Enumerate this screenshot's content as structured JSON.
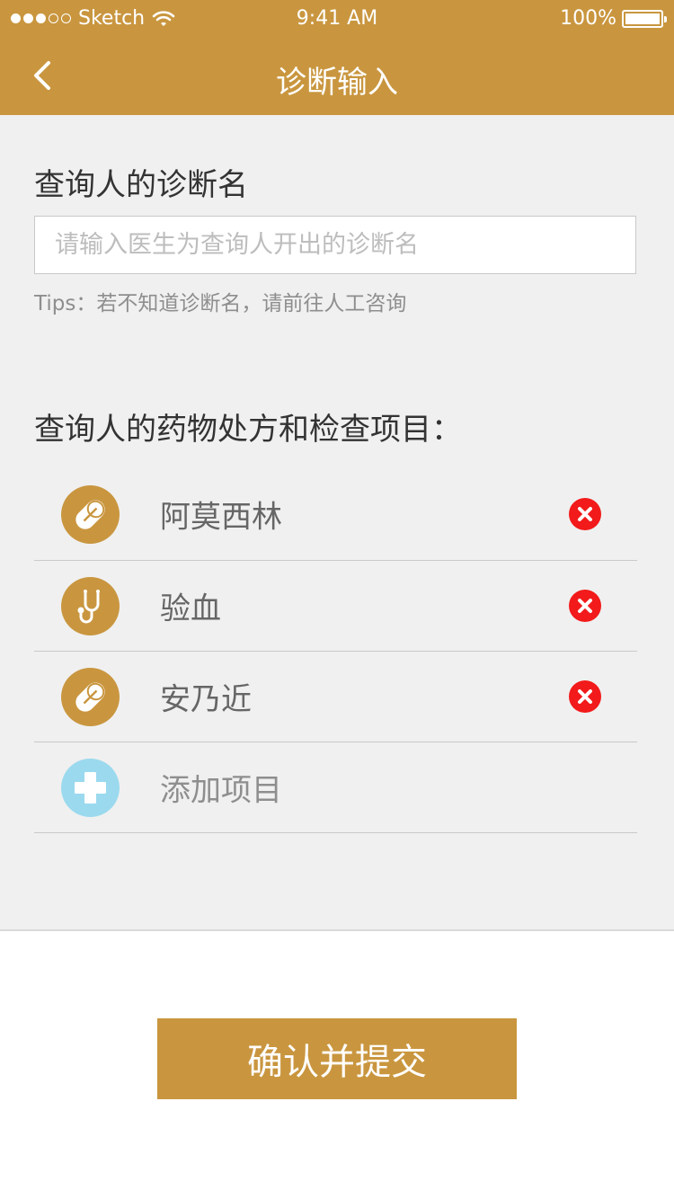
{
  "status_bar": {
    "carrier": "Sketch",
    "time": "9:41 AM",
    "battery": "100%",
    "signal_strength": 3,
    "signal_max": 5
  },
  "nav": {
    "title": "诊断输入",
    "back_icon": "chevron-left-icon"
  },
  "diagnosis": {
    "label": "查询人的诊断名",
    "placeholder": "请输入医生为查询人开出的诊断名",
    "value": "",
    "tips": "Tips：若不知道诊断名，请前往人工咨询"
  },
  "prescriptions": {
    "label": "查询人的药物处方和检查项目：",
    "items": [
      {
        "name": "阿莫西林",
        "icon": "pill-icon"
      },
      {
        "name": "验血",
        "icon": "stethoscope-icon"
      },
      {
        "name": "安乃近",
        "icon": "pill-icon"
      }
    ],
    "add_label": "添加项目",
    "add_icon": "plus-icon"
  },
  "submit": {
    "label": "确认并提交"
  },
  "colors": {
    "brand": "#C9963F",
    "delete": "#F21A1A",
    "add": "#9BD9EE",
    "background": "#F0F0F0"
  }
}
